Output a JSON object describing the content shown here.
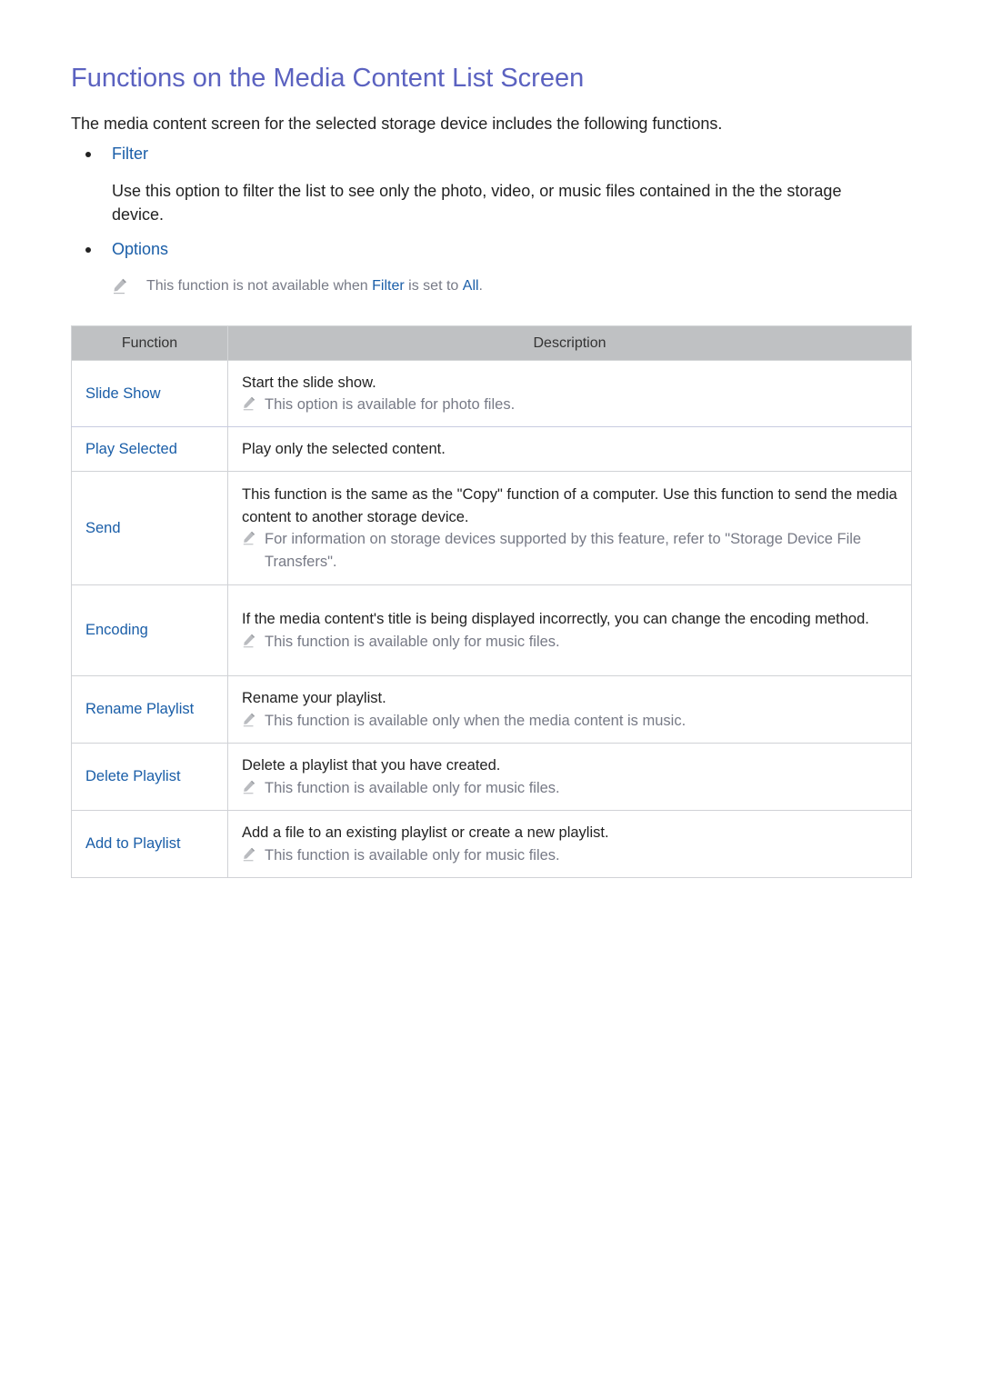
{
  "page": {
    "title": "Functions on the Media Content List Screen",
    "intro": "The media content screen for the selected storage device includes the following functions.",
    "bullets": [
      {
        "label": "Filter",
        "description": "Use this option to filter the list to see only the photo, video, or music files contained in the the storage device."
      },
      {
        "label": "Options"
      }
    ],
    "options_note": {
      "icon": "pencil-icon",
      "pre": "This function is not available when ",
      "filter": "Filter",
      "mid": " is set to ",
      "all": "All",
      "post": "."
    }
  },
  "table": {
    "headers": {
      "function": "Function",
      "description": "Description"
    },
    "rows": [
      {
        "function": "Slide Show",
        "description": "Start the slide show.",
        "note": "This option is available for photo files."
      },
      {
        "function": "Play Selected",
        "description": "Play only the selected content."
      },
      {
        "function": "Send",
        "description": "This function is the same as the \"Copy\" function of a computer. Use this function to send the media content to another storage device.",
        "note": "For information on storage devices supported by this feature, refer to \"Storage Device File Transfers\"."
      },
      {
        "function": "Encoding",
        "description": "If the media content's title is being displayed incorrectly, you can change the encoding method.",
        "note": "This function is available only for music files."
      },
      {
        "function": "Rename Playlist",
        "description": "Rename your playlist.",
        "note": "This function is available only when the media content is music."
      },
      {
        "function": "Delete Playlist",
        "description": "Delete a playlist that you have created.",
        "note": "This function is available only for music files."
      },
      {
        "function": "Add to Playlist",
        "description": "Add a file to an existing playlist or create a new playlist.",
        "note": "This function is available only for music files."
      }
    ]
  },
  "colors": {
    "title": "#5b62c0",
    "link": "#1a5ea8",
    "note": "#777a86",
    "header_bg": "#bfc1c3"
  }
}
